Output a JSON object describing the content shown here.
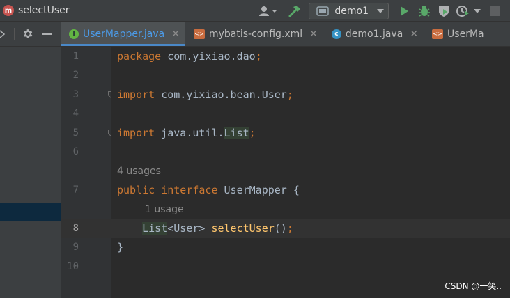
{
  "toolbar": {
    "method_icon": "method-icon",
    "breadcrumb": "selectUser",
    "run_config": "demo1",
    "icons": [
      "user-icon",
      "build-hammer-icon",
      "run-icon",
      "debug-icon",
      "coverage-icon",
      "profile-icon",
      "more-dropdown-icon",
      "stop-icon"
    ]
  },
  "tabs": [
    {
      "label": "UserMapper.java",
      "icon": "interface-icon",
      "active": true
    },
    {
      "label": "mybatis-config.xml",
      "icon": "xml-icon",
      "active": false
    },
    {
      "label": "demo1.java",
      "icon": "class-icon",
      "active": false
    },
    {
      "label": "UserMa",
      "icon": "xml-icon",
      "active": false
    }
  ],
  "editor": {
    "lines": [
      {
        "num": "1",
        "tokens": [
          {
            "t": "package",
            "c": "kw"
          },
          {
            "t": " com.yixiao.dao",
            "c": ""
          },
          {
            "t": ";",
            "c": "kw"
          }
        ]
      },
      {
        "num": "2",
        "tokens": []
      },
      {
        "num": "3",
        "tokens": [
          {
            "t": "import",
            "c": "kw"
          },
          {
            "t": " com.yixiao.bean.User",
            "c": ""
          },
          {
            "t": ";",
            "c": "kw"
          }
        ]
      },
      {
        "num": "4",
        "tokens": []
      },
      {
        "num": "5",
        "tokens": [
          {
            "t": "import",
            "c": "kw"
          },
          {
            "t": " java.util.",
            "c": ""
          },
          {
            "t": "List",
            "c": "hl"
          },
          {
            "t": ";",
            "c": "kw"
          }
        ]
      },
      {
        "num": "6",
        "tokens": []
      },
      {
        "num": "7",
        "hint": "4 usages",
        "tokens": [
          {
            "t": "public",
            "c": "kw"
          },
          {
            "t": " ",
            "c": ""
          },
          {
            "t": "interface",
            "c": "kw"
          },
          {
            "t": " UserMapper {",
            "c": ""
          }
        ]
      },
      {
        "num": "8",
        "hint": "1 usage",
        "current": true,
        "tokens": [
          {
            "t": "    ",
            "c": ""
          },
          {
            "t": "List",
            "c": "hl"
          },
          {
            "t": "<User> ",
            "c": ""
          },
          {
            "t": "selectUser",
            "c": "fn"
          },
          {
            "t": "()",
            "c": ""
          },
          {
            "t": ";",
            "c": "kw"
          }
        ]
      },
      {
        "num": "9",
        "tokens": [
          {
            "t": "}",
            "c": ""
          }
        ]
      },
      {
        "num": "10",
        "tokens": []
      }
    ]
  },
  "watermark": "CSDN @一笑.."
}
